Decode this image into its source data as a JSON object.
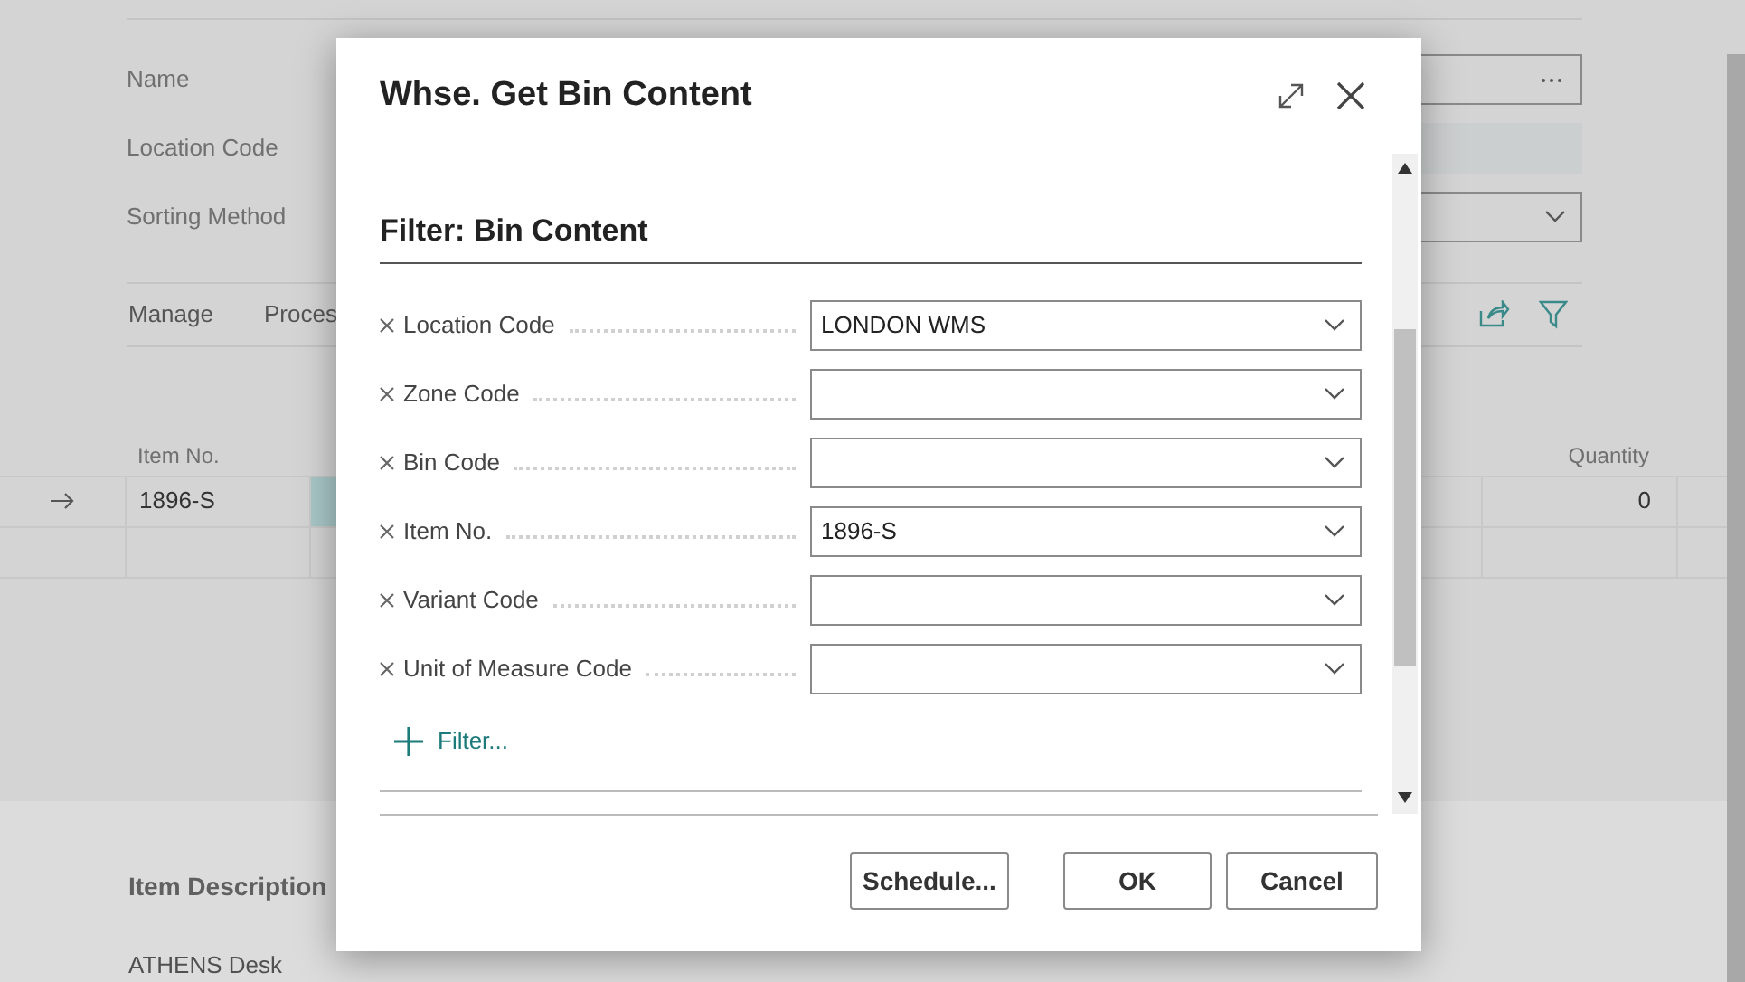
{
  "background_page": {
    "fields": [
      {
        "label": "Name",
        "kind": "lookup"
      },
      {
        "label": "Location Code",
        "kind": "readonly"
      },
      {
        "label": "Sorting Method",
        "kind": "dropdown"
      }
    ],
    "actions": [
      "Manage",
      "Proces"
    ],
    "table": {
      "columns": [
        "Item No.",
        "Quantity"
      ],
      "rows": [
        {
          "item_no": "1896-S",
          "quantity": "0",
          "selected": true
        }
      ]
    },
    "item_description": {
      "heading": "Item Description",
      "value": "ATHENS Desk"
    }
  },
  "dialog": {
    "title": "Whse. Get Bin Content",
    "section": "Filter: Bin Content",
    "filters": [
      {
        "label": "Location Code",
        "value": "LONDON WMS"
      },
      {
        "label": "Zone Code"
      },
      {
        "label": "Bin Code"
      },
      {
        "label": "Item No.",
        "value": "1896-S"
      },
      {
        "label": "Variant Code"
      },
      {
        "label": "Unit of Measure Code"
      }
    ],
    "add_filter": "Filter...",
    "buttons": [
      "Schedule...",
      "OK",
      "Cancel"
    ]
  }
}
